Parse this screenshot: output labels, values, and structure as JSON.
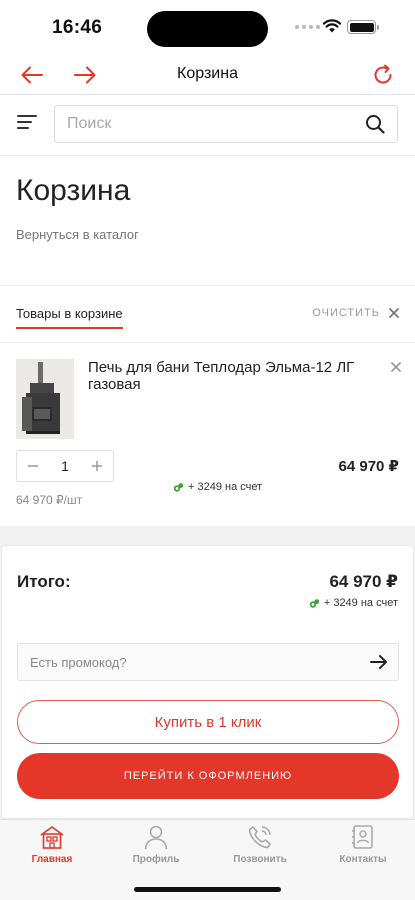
{
  "status_bar": {
    "time": "16:46"
  },
  "browser_bar": {
    "title": "Корзина"
  },
  "header": {
    "search_placeholder": "Поиск"
  },
  "page": {
    "title": "Корзина",
    "back_link": "Вернуться в каталог"
  },
  "cart_tabs": {
    "active_tab": "Товары в корзине",
    "clear_label": "ОЧИСТИТЬ"
  },
  "cart_item": {
    "name": "Печь для бани Теплодар Эльма-12 ЛГ газовая",
    "quantity": "1",
    "price": "64 970 ₽",
    "bonus": "+ 3249 на счет",
    "unit_price": "64 970 ₽/шт"
  },
  "summary": {
    "label": "Итого:",
    "total": "64 970 ₽",
    "bonus": "+ 3249 на счет",
    "promo_placeholder": "Есть промокод?",
    "one_click_label": "Купить в 1 клик",
    "checkout_label": "ПЕРЕЙТИ К ОФОРМЛЕНИЮ"
  },
  "tabbar": [
    {
      "label": "Главная",
      "icon": "home-icon",
      "active": true
    },
    {
      "label": "Профиль",
      "icon": "profile-icon",
      "active": false
    },
    {
      "label": "Позвонить",
      "icon": "phone-icon",
      "active": false
    },
    {
      "label": "Контакты",
      "icon": "contacts-icon",
      "active": false
    }
  ],
  "colors": {
    "accent": "#e5362a",
    "bonus_green": "#3aa635"
  }
}
